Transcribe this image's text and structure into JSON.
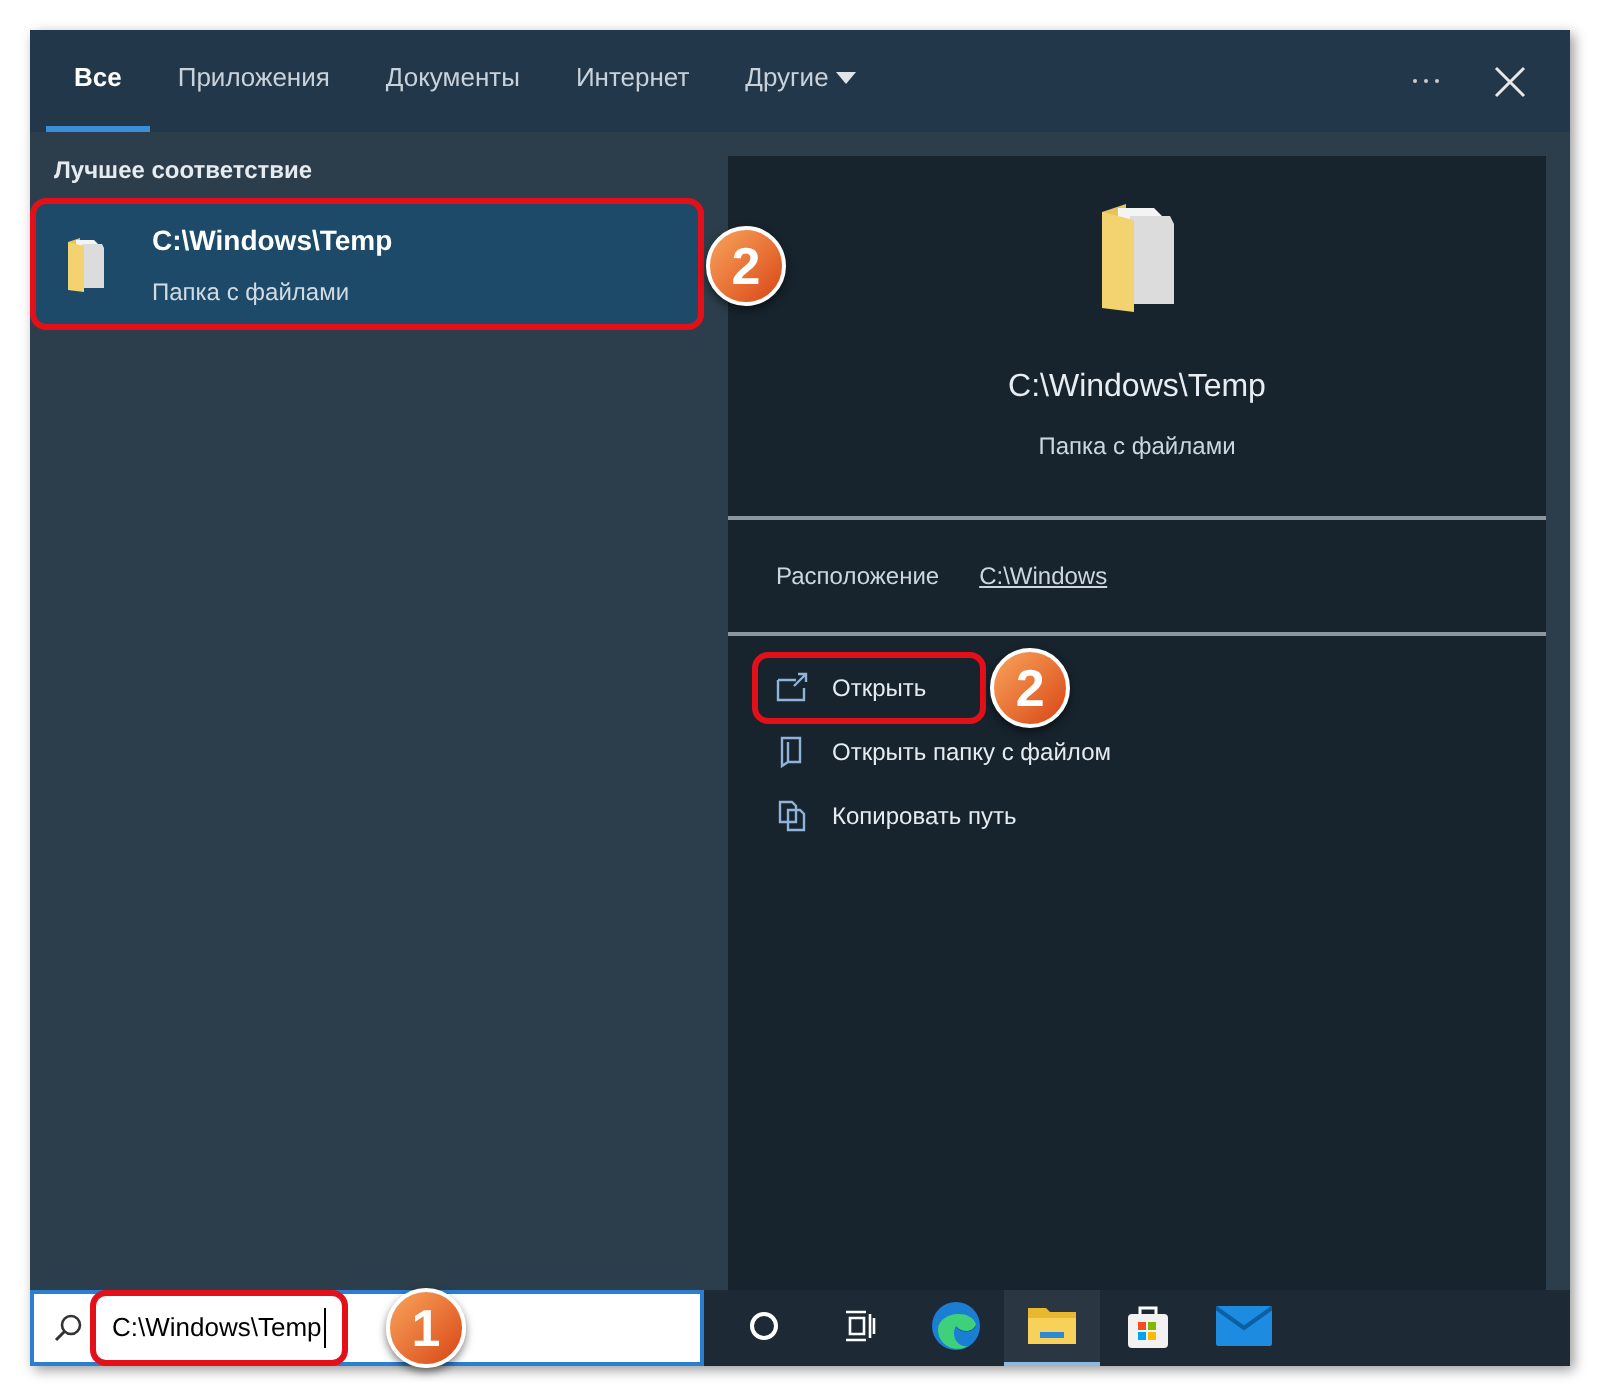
{
  "tabs": [
    {
      "label": "Все",
      "selected": true,
      "kind": "plain"
    },
    {
      "label": "Приложения",
      "selected": false,
      "kind": "plain"
    },
    {
      "label": "Документы",
      "selected": false,
      "kind": "plain"
    },
    {
      "label": "Интернет",
      "selected": false,
      "kind": "plain"
    },
    {
      "label": "Другие",
      "selected": false,
      "kind": "dropdown"
    }
  ],
  "section_title": "Лучшее соответствие",
  "results": [
    {
      "title": "C:\\Windows\\Temp",
      "subtitle": "Папка с файлами",
      "selected": true,
      "callout": "2"
    }
  ],
  "preview": {
    "title": "C:\\Windows\\Temp",
    "subtitle": "Папка с файлами",
    "location_label": "Расположение",
    "location_link": "C:\\Windows",
    "actions": [
      {
        "label": "Открыть",
        "kind": "open",
        "callout": "2"
      },
      {
        "label": "Открыть папку с файлом",
        "kind": "folder"
      },
      {
        "label": "Копировать путь",
        "kind": "copy"
      }
    ]
  },
  "search": {
    "value": "C:\\Windows\\Temp",
    "callout": "1"
  },
  "taskbar": [
    {
      "kind": "cortana",
      "selected": false
    },
    {
      "kind": "taskview",
      "selected": false
    },
    {
      "kind": "browser",
      "selected": false
    },
    {
      "kind": "explorer",
      "selected": true
    },
    {
      "kind": "store",
      "selected": false
    },
    {
      "kind": "mail",
      "selected": false
    }
  ]
}
